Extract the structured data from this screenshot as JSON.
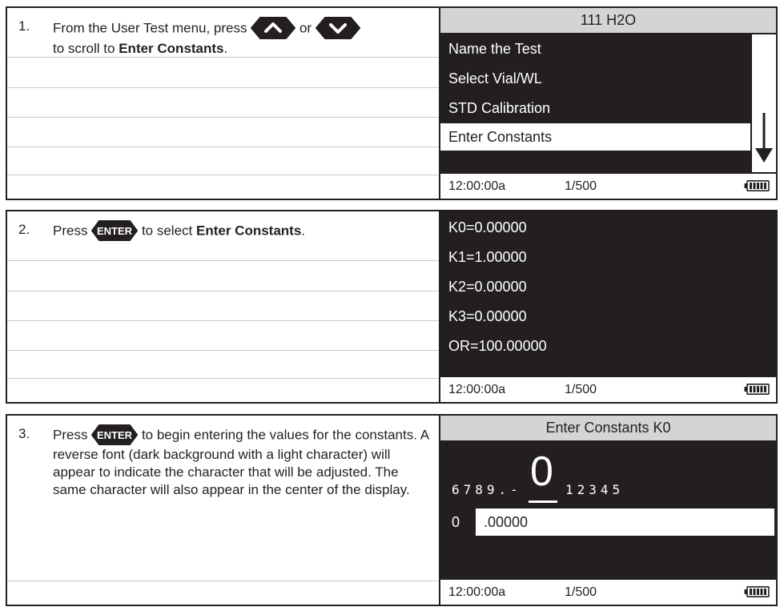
{
  "step1": {
    "number": "1.",
    "text_a": "From the User Test menu, press",
    "text_or": "or",
    "text_b": "to scroll to",
    "text_bold": "Enter Constants",
    "text_end": ".",
    "screen": {
      "title": "111 H2O",
      "items": [
        "Name the Test",
        "Select Vial/WL",
        "STD Calibration",
        "Enter Constants"
      ],
      "status_time": "12:00:00a",
      "status_count": "1/500"
    }
  },
  "step2": {
    "number": "2.",
    "text_a": "Press",
    "text_b": "to select",
    "text_bold": "Enter Constants",
    "text_end": ".",
    "screen": {
      "items": [
        "K0=0.00000",
        "K1=1.00000",
        "K2=0.00000",
        "K3=0.00000",
        "OR=100.00000"
      ],
      "status_time": "12:00:00a",
      "status_count": "1/500"
    }
  },
  "step3": {
    "number": "3.",
    "text_a": "Press",
    "text_b": "to begin entering the values for the constants. A reverse font (dark background with a light character) will appear to indicate the character that will be adjusted. The same character will also appear in the center of the display.",
    "screen": {
      "title": "Enter Constants K0",
      "digits_left": "6789.-",
      "big_digit": "0",
      "digits_right": "12345",
      "entry_prefix": "0",
      "entry_value": ".00000",
      "status_time": "12:00:00a",
      "status_count": "1/500"
    }
  },
  "keys": {
    "enter_label": "ENTER"
  },
  "icons": {
    "up": "up-arrow-key-icon",
    "down": "down-arrow-key-icon",
    "enter": "enter-key-icon",
    "battery": "battery-icon",
    "scroll": "scroll-down-arrow-icon"
  },
  "colors": {
    "screen_bg": "#231f20",
    "title_bg": "#d4d4d4",
    "text": "#231f20"
  }
}
